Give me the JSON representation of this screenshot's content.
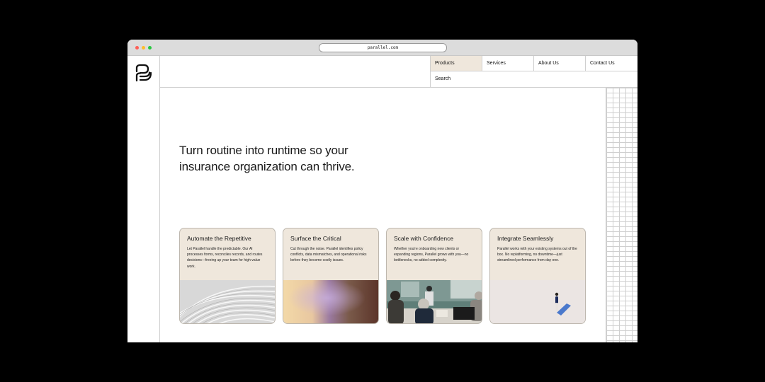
{
  "browser": {
    "url": "parallel.com"
  },
  "nav": {
    "items": [
      {
        "label": "Products",
        "active": true
      },
      {
        "label": "Services",
        "active": false
      },
      {
        "label": "About Us",
        "active": false
      },
      {
        "label": "Contact Us",
        "active": false
      }
    ],
    "search_label": "Search"
  },
  "hero": {
    "line1": "Turn routine into runtime so your",
    "line2": "insurance organization can thrive."
  },
  "cards": [
    {
      "title": "Automate the Repetitive",
      "text": "Let Parallel handle the predictable. Our AI processes forms, reconciles records, and routes decisions—freeing up your team for high-value work.",
      "image": "abstract-white-curves"
    },
    {
      "title": "Surface the Critical",
      "text": "Cut through the noise. Parallel identifies policy conflicts, data mismatches, and operational risks before they become costly issues.",
      "image": "blurred-color-gradient"
    },
    {
      "title": "Scale with Confidence",
      "text": "Whether you're onboarding new clients or expanding regions, Parallel grows with you—no bottlenecks, no added complexity.",
      "image": "office-meeting-photo"
    },
    {
      "title": "Integrate Seamlessly",
      "text": "Parallel works with your existing systems out of the box. No replatforming, no downtime—just streamlined performance from day one.",
      "image": "person-with-shadow"
    }
  ],
  "colors": {
    "accent": "#efe7dc",
    "border": "#cfcfcf",
    "text": "#1a1a1a"
  }
}
